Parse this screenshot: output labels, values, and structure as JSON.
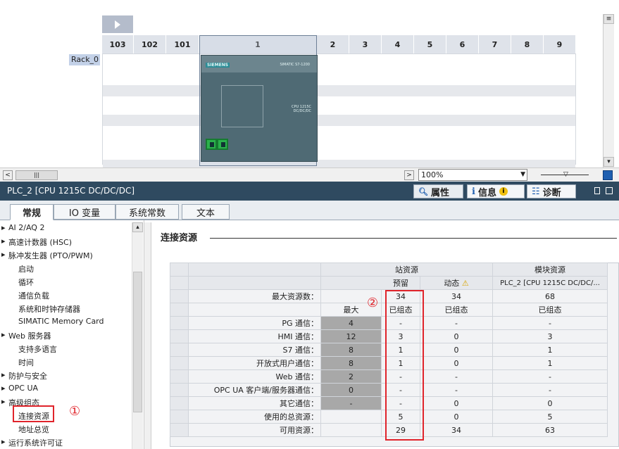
{
  "device_view": {
    "rack_label": "Rack_0",
    "slots": [
      "103",
      "102",
      "101",
      "1",
      "2",
      "3",
      "4",
      "5",
      "6",
      "7",
      "8",
      "9"
    ],
    "plc_brand": "SIEMENS",
    "plc_model": "SIMATIC S7-1200",
    "plc_type_label": "CPU 1215C\nDC/DC/DC",
    "zoom": "100%"
  },
  "inspector": {
    "title": "PLC_2 [CPU 1215C DC/DC/DC]",
    "tabs": {
      "properties": "属性",
      "info": "信息",
      "diagnostics": "诊断"
    },
    "main_tabs": [
      "常规",
      "IO 变量",
      "系统常数",
      "文本"
    ]
  },
  "tree": {
    "items": [
      {
        "label": "AI 2/AQ 2",
        "arrow": true
      },
      {
        "label": "高速计数器 (HSC)",
        "arrow": true
      },
      {
        "label": "脉冲发生器 (PTO/PWM)",
        "arrow": true
      },
      {
        "label": "启动",
        "arrow": false
      },
      {
        "label": "循环",
        "arrow": false
      },
      {
        "label": "通信负载",
        "arrow": false
      },
      {
        "label": "系统和时钟存储器",
        "arrow": false
      },
      {
        "label": "SIMATIC Memory Card",
        "arrow": false
      },
      {
        "label": "Web 服务器",
        "arrow": true
      },
      {
        "label": "支持多语言",
        "arrow": false
      },
      {
        "label": "时间",
        "arrow": false
      },
      {
        "label": "防护与安全",
        "arrow": true
      },
      {
        "label": "OPC UA",
        "arrow": true
      },
      {
        "label": "高级组态",
        "arrow": true
      },
      {
        "label": "连接资源",
        "arrow": false
      },
      {
        "label": "地址总览",
        "arrow": false
      },
      {
        "label": "运行系统许可证",
        "arrow": true
      }
    ],
    "marker": "①"
  },
  "section": {
    "title": "连接资源",
    "marker": "②"
  },
  "table": {
    "group_station": "站资源",
    "group_module": "模块资源",
    "sub_reserved": "预留",
    "sub_dynamic": "动态",
    "sub_module": "PLC_2 [CPU 1215C DC/DC/...",
    "max_label": "最大资源数：",
    "max_reserved": "34",
    "max_dynamic": "34",
    "max_module": "68",
    "col_max": "最大",
    "col_configured": "已组态",
    "col_dyn_configured": "已组态",
    "col_mod_configured": "已组态",
    "rows": [
      {
        "label": "PG 通信：",
        "max": "4",
        "cfg": "-",
        "dyn": "-",
        "mod": "-"
      },
      {
        "label": "HMI 通信：",
        "max": "12",
        "cfg": "3",
        "dyn": "0",
        "mod": "3"
      },
      {
        "label": "S7 通信：",
        "max": "8",
        "cfg": "1",
        "dyn": "0",
        "mod": "1"
      },
      {
        "label": "开放式用户通信：",
        "max": "8",
        "cfg": "1",
        "dyn": "0",
        "mod": "1"
      },
      {
        "label": "Web 通信：",
        "max": "2",
        "cfg": "-",
        "dyn": "-",
        "mod": "-"
      },
      {
        "label": "OPC UA 客户端/服务器通信：",
        "max": "0",
        "cfg": "-",
        "dyn": "-",
        "mod": "-"
      },
      {
        "label": "其它通信：",
        "max": "-",
        "cfg": "-",
        "dyn": "0",
        "mod": "0"
      }
    ],
    "total_used_label": "使用的总资源：",
    "total_used": {
      "cfg": "5",
      "dyn": "0",
      "mod": "5"
    },
    "available_label": "可用资源：",
    "available": {
      "cfg": "29",
      "dyn": "34",
      "mod": "63"
    }
  },
  "colors": {
    "accent_red": "#e0242b",
    "header_bar": "#2f4a60"
  }
}
